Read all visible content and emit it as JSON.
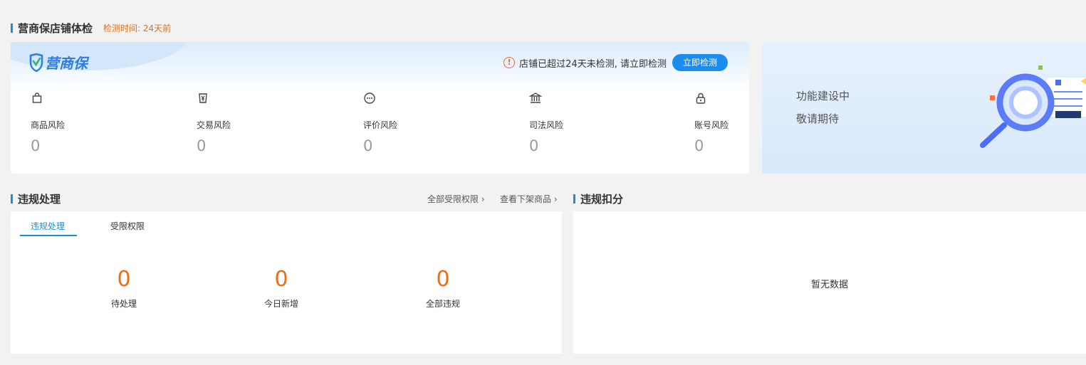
{
  "health": {
    "title": "营商保店铺体检",
    "detect_time": "检测时间: 24天前",
    "logo_text": "营商保",
    "alert_text": "店铺已超过24天未检测, 请立即检测",
    "alert_icon": "!",
    "detect_button": "立即检测",
    "risks": [
      {
        "icon": "bag-icon",
        "label": "商品风险",
        "value": "0"
      },
      {
        "icon": "yen-card-icon",
        "label": "交易风险",
        "value": "0"
      },
      {
        "icon": "chat-bubble-icon",
        "label": "评价风险",
        "value": "0"
      },
      {
        "icon": "courthouse-icon",
        "label": "司法风险",
        "value": "0"
      },
      {
        "icon": "lock-icon",
        "label": "账号风险",
        "value": "0"
      }
    ]
  },
  "promo": {
    "line1": "功能建设中",
    "line2": "敬请期待"
  },
  "violation": {
    "title": "违规处理",
    "link_restrictions": "全部受限权限 ›",
    "link_delisted": "查看下架商品 ›",
    "tabs": [
      "违规处理",
      "受限权限"
    ],
    "stats": [
      {
        "value": "0",
        "label": "待处理"
      },
      {
        "value": "0",
        "label": "今日新增"
      },
      {
        "value": "0",
        "label": "全部违规"
      }
    ]
  },
  "deduction": {
    "title": "违规扣分",
    "empty": "暂无数据"
  },
  "colors": {
    "accent": "#1a8fd8",
    "orange": "#f26a12",
    "button": "#1b8cf0"
  }
}
